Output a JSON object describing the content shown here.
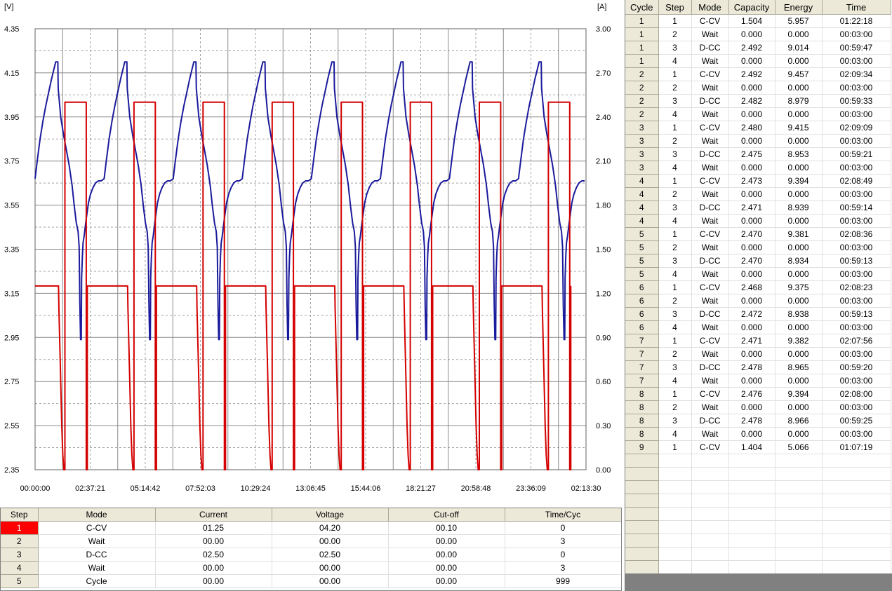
{
  "chart_data": {
    "type": "line",
    "left_axis_unit": "[V]",
    "right_axis_unit": "[A]",
    "ylim_left": [
      2.35,
      4.35
    ],
    "ylim_right": [
      0.0,
      3.0
    ],
    "yticks_left": [
      "4.35",
      "4.15",
      "3.95",
      "3.75",
      "3.55",
      "3.35",
      "3.15",
      "2.95",
      "2.75",
      "2.55",
      "2.35"
    ],
    "yticks_right": [
      "3.00",
      "2.70",
      "2.40",
      "2.10",
      "1.80",
      "1.50",
      "1.20",
      "0.90",
      "0.60",
      "0.30",
      "0.00"
    ],
    "xticks": [
      "00:00:00",
      "02:37:21",
      "05:14:42",
      "07:52:03",
      "10:29:24",
      "13:06:45",
      "15:44:06",
      "18:21:27",
      "20:58:48",
      "23:36:09",
      "02:13:30"
    ],
    "grid": true,
    "colors": {
      "voltage": "#1a1a9c",
      "current": "#d40000",
      "grid_solid": "#8a8a8a",
      "grid_dashed": "#a0a0a0"
    },
    "series": [
      {
        "axis": "left",
        "color": "#1a1a9c",
        "cycle_period_minutes": 194.3,
        "cycle_template": [
          [
            0,
            3.67
          ],
          [
            6,
            3.75
          ],
          [
            14,
            3.85
          ],
          [
            22,
            3.93
          ],
          [
            30,
            4.0
          ],
          [
            38,
            4.06
          ],
          [
            46,
            4.12
          ],
          [
            52,
            4.16
          ],
          [
            58,
            4.2
          ],
          [
            64,
            4.2
          ],
          [
            65,
            4.08
          ],
          [
            72,
            3.95
          ],
          [
            80,
            3.87
          ],
          [
            88,
            3.8
          ],
          [
            96,
            3.73
          ],
          [
            104,
            3.64
          ],
          [
            110,
            3.55
          ],
          [
            116,
            3.47
          ],
          [
            121,
            3.43
          ],
          [
            124,
            3.36
          ],
          [
            126,
            3.1
          ],
          [
            128,
            2.94
          ],
          [
            130,
            2.94
          ],
          [
            131,
            3.22
          ],
          [
            133,
            3.32
          ],
          [
            135,
            3.38
          ],
          [
            138,
            3.41
          ],
          [
            141,
            3.45
          ],
          [
            145,
            3.5
          ],
          [
            150,
            3.56
          ],
          [
            156,
            3.6
          ],
          [
            163,
            3.63
          ],
          [
            170,
            3.65
          ],
          [
            178,
            3.66
          ],
          [
            186,
            3.66
          ],
          [
            194.3,
            3.67
          ]
        ]
      },
      {
        "axis": "right",
        "color": "#d40000",
        "cycle_period_minutes": 194.3,
        "cycle_template": [
          [
            0,
            1.25
          ],
          [
            66,
            1.25
          ],
          [
            67,
            1.1
          ],
          [
            71,
            0.7
          ],
          [
            75,
            0.3
          ],
          [
            78,
            0.1
          ],
          [
            81,
            0.0
          ],
          [
            84,
            0.0
          ],
          [
            84,
            2.5
          ],
          [
            144,
            2.5
          ],
          [
            144,
            0.0
          ],
          [
            147,
            0.0
          ],
          [
            147,
            1.25
          ],
          [
            194.3,
            1.25
          ]
        ]
      }
    ]
  },
  "program_table": {
    "headers": [
      "Step",
      "Mode",
      "Current",
      "Voltage",
      "Cut-off",
      "Time/Cyc"
    ],
    "rows": [
      {
        "step": "1",
        "mode": "C-CV",
        "current": "01.25",
        "voltage": "04.20",
        "cutoff": "00.10",
        "time": "0"
      },
      {
        "step": "2",
        "mode": "Wait",
        "current": "00.00",
        "voltage": "00.00",
        "cutoff": "00.00",
        "time": "3"
      },
      {
        "step": "3",
        "mode": "D-CC",
        "current": "02.50",
        "voltage": "02.50",
        "cutoff": "00.00",
        "time": "0"
      },
      {
        "step": "4",
        "mode": "Wait",
        "current": "00.00",
        "voltage": "00.00",
        "cutoff": "00.00",
        "time": "3"
      },
      {
        "step": "5",
        "mode": "Cycle",
        "current": "00.00",
        "voltage": "00.00",
        "cutoff": "00.00",
        "time": "999"
      }
    ],
    "active_step": "1",
    "active_color": "#ff0000"
  },
  "log_table": {
    "headers": [
      "Cycle",
      "Step",
      "Mode",
      "Capacity",
      "Energy",
      "Time"
    ],
    "rows": [
      [
        "1",
        "1",
        "C-CV",
        "1.504",
        "5.957",
        "01:22:18"
      ],
      [
        "1",
        "2",
        "Wait",
        "0.000",
        "0.000",
        "00:03:00"
      ],
      [
        "1",
        "3",
        "D-CC",
        "2.492",
        "9.014",
        "00:59:47"
      ],
      [
        "1",
        "4",
        "Wait",
        "0.000",
        "0.000",
        "00:03:00"
      ],
      [
        "2",
        "1",
        "C-CV",
        "2.492",
        "9.457",
        "02:09:34"
      ],
      [
        "2",
        "2",
        "Wait",
        "0.000",
        "0.000",
        "00:03:00"
      ],
      [
        "2",
        "3",
        "D-CC",
        "2.482",
        "8.979",
        "00:59:33"
      ],
      [
        "2",
        "4",
        "Wait",
        "0.000",
        "0.000",
        "00:03:00"
      ],
      [
        "3",
        "1",
        "C-CV",
        "2.480",
        "9.415",
        "02:09:09"
      ],
      [
        "3",
        "2",
        "Wait",
        "0.000",
        "0.000",
        "00:03:00"
      ],
      [
        "3",
        "3",
        "D-CC",
        "2.475",
        "8.953",
        "00:59:21"
      ],
      [
        "3",
        "4",
        "Wait",
        "0.000",
        "0.000",
        "00:03:00"
      ],
      [
        "4",
        "1",
        "C-CV",
        "2.473",
        "9.394",
        "02:08:49"
      ],
      [
        "4",
        "2",
        "Wait",
        "0.000",
        "0.000",
        "00:03:00"
      ],
      [
        "4",
        "3",
        "D-CC",
        "2.471",
        "8.939",
        "00:59:14"
      ],
      [
        "4",
        "4",
        "Wait",
        "0.000",
        "0.000",
        "00:03:00"
      ],
      [
        "5",
        "1",
        "C-CV",
        "2.470",
        "9.381",
        "02:08:36"
      ],
      [
        "5",
        "2",
        "Wait",
        "0.000",
        "0.000",
        "00:03:00"
      ],
      [
        "5",
        "3",
        "D-CC",
        "2.470",
        "8.934",
        "00:59:13"
      ],
      [
        "5",
        "4",
        "Wait",
        "0.000",
        "0.000",
        "00:03:00"
      ],
      [
        "6",
        "1",
        "C-CV",
        "2.468",
        "9.375",
        "02:08:23"
      ],
      [
        "6",
        "2",
        "Wait",
        "0.000",
        "0.000",
        "00:03:00"
      ],
      [
        "6",
        "3",
        "D-CC",
        "2.472",
        "8.938",
        "00:59:13"
      ],
      [
        "6",
        "4",
        "Wait",
        "0.000",
        "0.000",
        "00:03:00"
      ],
      [
        "7",
        "1",
        "C-CV",
        "2.471",
        "9.382",
        "02:07:56"
      ],
      [
        "7",
        "2",
        "Wait",
        "0.000",
        "0.000",
        "00:03:00"
      ],
      [
        "7",
        "3",
        "D-CC",
        "2.478",
        "8.965",
        "00:59:20"
      ],
      [
        "7",
        "4",
        "Wait",
        "0.000",
        "0.000",
        "00:03:00"
      ],
      [
        "8",
        "1",
        "C-CV",
        "2.476",
        "9.394",
        "02:08:00"
      ],
      [
        "8",
        "2",
        "Wait",
        "0.000",
        "0.000",
        "00:03:00"
      ],
      [
        "8",
        "3",
        "D-CC",
        "2.478",
        "8.966",
        "00:59:25"
      ],
      [
        "8",
        "4",
        "Wait",
        "0.000",
        "0.000",
        "00:03:00"
      ],
      [
        "9",
        "1",
        "C-CV",
        "1.404",
        "5.066",
        "01:07:19"
      ]
    ]
  }
}
